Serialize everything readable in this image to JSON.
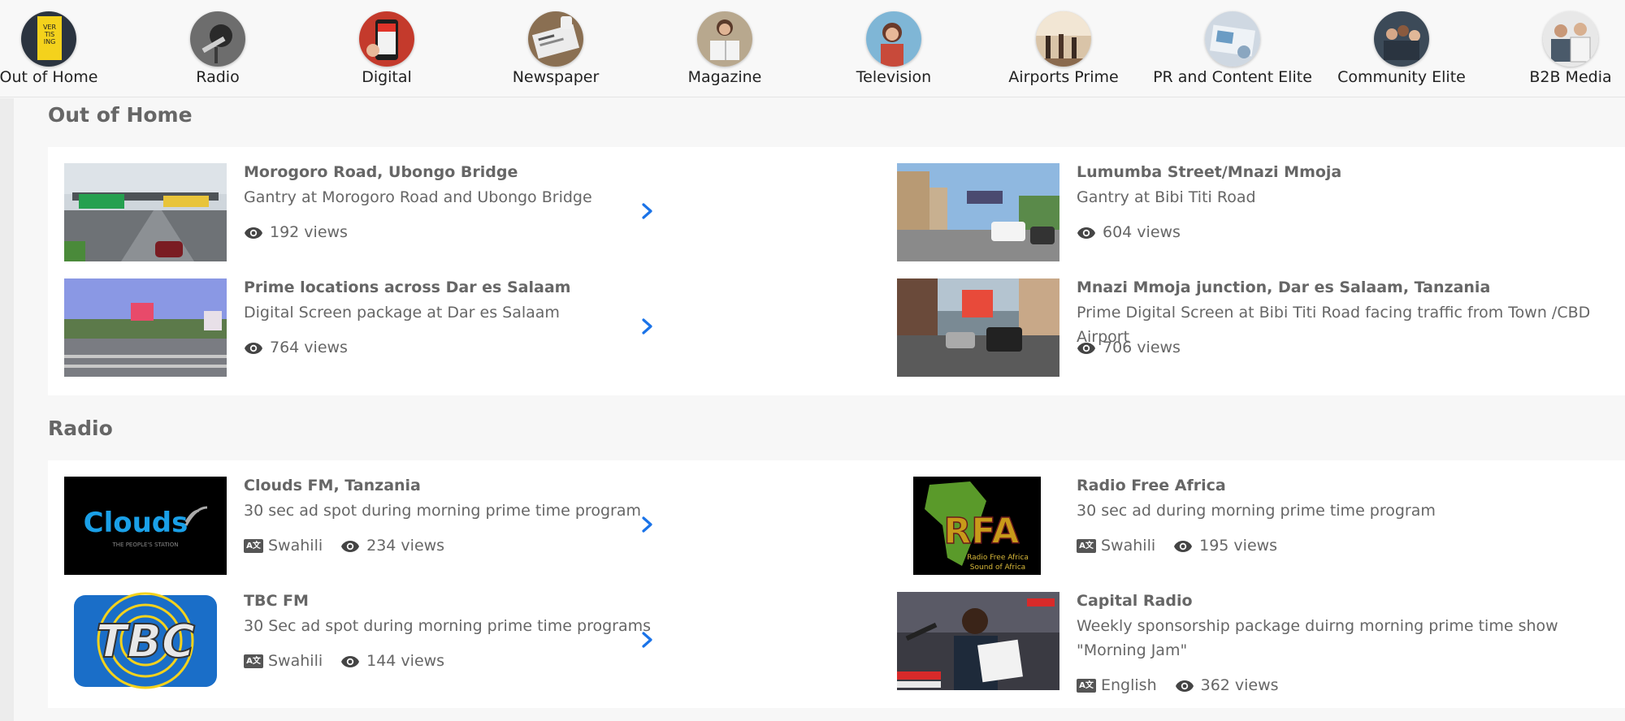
{
  "categories": [
    {
      "label": "Out of Home"
    },
    {
      "label": "Radio"
    },
    {
      "label": "Digital"
    },
    {
      "label": "Newspaper"
    },
    {
      "label": "Magazine"
    },
    {
      "label": "Television"
    },
    {
      "label": "Airports Prime"
    },
    {
      "label": "PR and Content Elite"
    },
    {
      "label": "Community Elite"
    },
    {
      "label": "B2B Media"
    }
  ],
  "sections": [
    {
      "title": "Out of Home",
      "items": [
        {
          "title": "Morogoro Road, Ubongo Bridge",
          "desc": "Gantry at Morogoro Road and Ubongo Bridge",
          "views": "192 views"
        },
        {
          "title": "Lumumba Street/Mnazi Mmoja",
          "desc": "Gantry at Bibi Titi Road",
          "views": "604 views"
        },
        {
          "title": "Prime locations across Dar es Salaam",
          "desc": "Digital Screen package at Dar es Salaam",
          "views": "764 views"
        },
        {
          "title": "Mnazi Mmoja junction, Dar es Salaam, Tanzania",
          "desc": "Prime Digital Screen at Bibi Titi Road facing traffic from Town /CBD Airport",
          "views": "706 views"
        }
      ]
    },
    {
      "title": "Radio",
      "items": [
        {
          "title": "Clouds FM, Tanzania",
          "desc": "30 sec ad spot during morning prime time program",
          "language": "Swahili",
          "views": "234 views",
          "logo_text": "Clouds",
          "logo_sub": "THE PEOPLE'S STATION"
        },
        {
          "title": "Radio Free Africa",
          "desc": "30 sec ad during morning prime time program",
          "language": "Swahili",
          "views": "195 views",
          "logo_text": "RFA",
          "logo_sub1": "Radio Free Africa",
          "logo_sub2": "Sound of Africa"
        },
        {
          "title": "TBC FM",
          "desc": "30 Sec ad spot during morning prime time programs",
          "language": "Swahili",
          "views": "144 views",
          "logo_text": "TBC"
        },
        {
          "title": "Capital Radio",
          "desc": "Weekly sponsorship package duirng morning prime time show \"Morning Jam\"",
          "language": "English",
          "views": "362 views"
        }
      ]
    }
  ],
  "icons": {
    "views": "eye-icon",
    "language": "language-icon",
    "next": "chevron-right-icon"
  },
  "colors": {
    "accent": "#1a73e8",
    "text": "#666666"
  }
}
